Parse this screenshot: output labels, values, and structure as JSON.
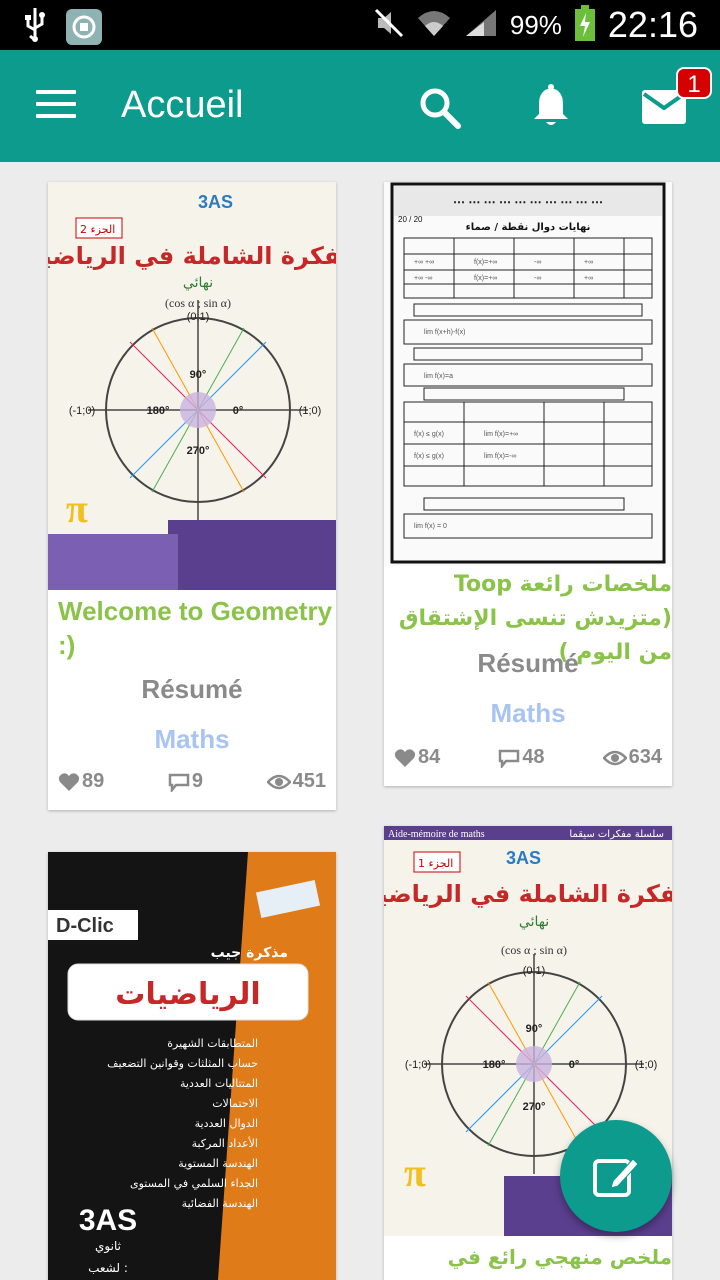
{
  "status_bar": {
    "battery": "99%",
    "time": "22:16",
    "icons": [
      "usb-icon",
      "app-notification-icon",
      "mute-icon",
      "wifi-icon",
      "signal-icon",
      "battery-icon"
    ]
  },
  "app_bar": {
    "title": "Accueil",
    "mail_badge": "1",
    "color": "#0c9b8c"
  },
  "cards": [
    {
      "title": "Welcome to Geometry :)",
      "category": "Résumé",
      "subject": "Maths",
      "likes": "89",
      "comments": "9",
      "views": "451"
    },
    {
      "title": "ملخصات رائعة Toop (متزيدش تنسى الإشتقاق من اليوم )",
      "category": "Résumé",
      "subject": "Maths",
      "likes": "84",
      "comments": "48",
      "views": "634"
    },
    {
      "thumb_text": {
        "brand": "D-Clic",
        "pre_title": "مذكرة جيب",
        "title": "الرياضيات",
        "level": "3AS",
        "level_sub": "ثانوي",
        "branch": "لشعب :",
        "topics": [
          "المتطابقات الشهيرة",
          "حساب المثلثات وقوانين التضعيف",
          "المتتاليات العددية",
          "الاحتمالات",
          "الدوال العددية",
          "الأعداد المركبة",
          "الهندسة المستوية",
          "الجداء السلمي في المستوى",
          "الهندسة الفضائية"
        ]
      }
    },
    {
      "title": "ملخص منهجي رائع في"
    }
  ],
  "thumb_book": {
    "title": "المفكرة الشاملة في الرياضيات",
    "level": "3AS",
    "part_1": "الجزء 1",
    "part_2": "الجزء 2",
    "subtitle": "نهائي",
    "formula": "(cos α ; sin α)",
    "series": "سلسلة مفكرات سيقما",
    "aide": "Aide-mémoire de maths"
  },
  "thumb_sheet": {
    "header": "نهايات دوال نقطة / صماء",
    "page": "20 / 20"
  }
}
